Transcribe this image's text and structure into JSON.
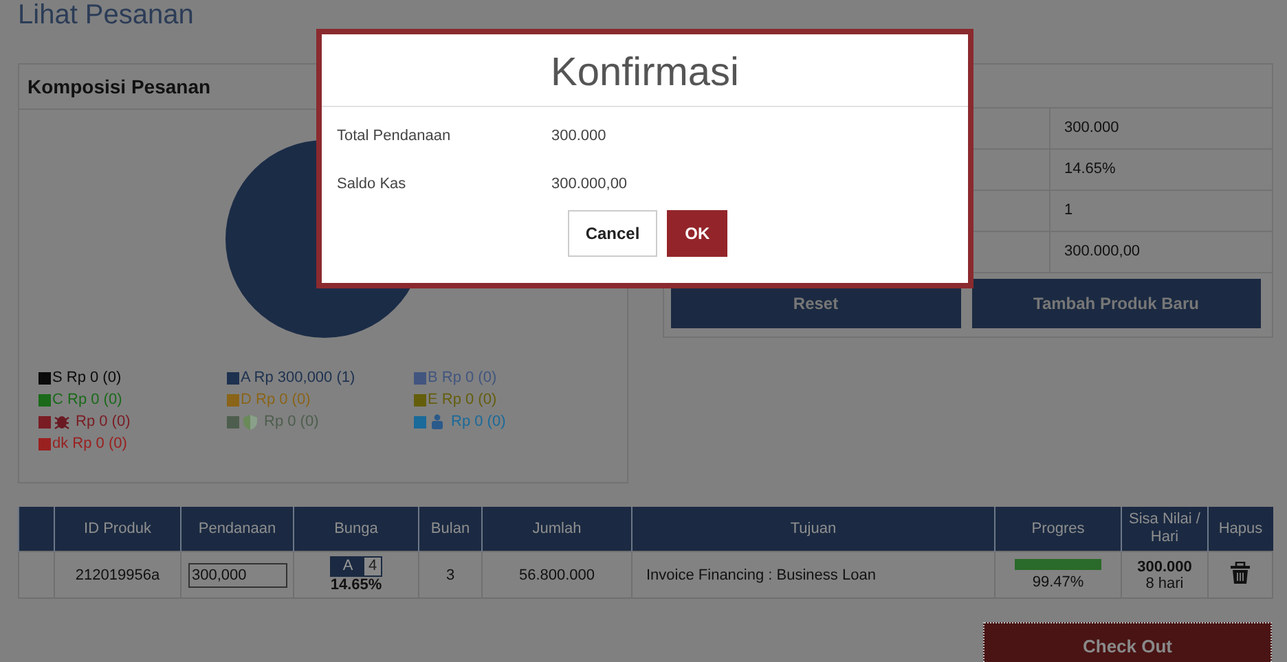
{
  "page": {
    "title": "Lihat Pesanan"
  },
  "composition_panel": {
    "title": "Komposisi Pesanan",
    "legend": [
      {
        "kind": "text",
        "label": "S Rp 0 (0)",
        "color": "#0a0a0a"
      },
      {
        "kind": "text",
        "label": "A Rp 300,000 (1)",
        "color": "#1e3250"
      },
      {
        "kind": "text",
        "label": "B Rp 0 (0)",
        "color": "#41557f"
      },
      {
        "kind": "text",
        "label": "C Rp 0 (0)",
        "color": "#1a6a1a"
      },
      {
        "kind": "text",
        "label": "D Rp 0 (0)",
        "color": "#8a6418"
      },
      {
        "kind": "text",
        "label": "E Rp 0 (0)",
        "color": "#645e0c"
      },
      {
        "kind": "icon",
        "label": "Rp 0 (0)",
        "color": "#7a1c24"
      },
      {
        "kind": "icon",
        "label": "Rp 0 (0)",
        "color": "#4e5e4e"
      },
      {
        "kind": "icon",
        "label": "Rp 0 (0)",
        "color": "#1a6a9a"
      },
      {
        "kind": "text",
        "label": "dk Rp 0 (0)",
        "color": "#9a2020"
      }
    ]
  },
  "summary_panel": {
    "values": [
      "300.000",
      "14.65%",
      "1",
      "300.000,00"
    ],
    "buttons": [
      "Reset",
      "Tambah Produk Baru"
    ]
  },
  "table": {
    "columns": [
      "ID Produk",
      "Pendanaan",
      "Bunga",
      "Bulan",
      "Jumlah",
      "Tujuan",
      "Progres",
      "Sisa Nilai / Hari",
      "Hapus"
    ],
    "rows": [
      {
        "id": "212019956a",
        "pendanaan": "300,000",
        "grade": "A",
        "grade_number": "4",
        "bunga": "14.65%",
        "bulan": "3",
        "jumlah": "56.800.000",
        "tujuan": "Invoice Financing : Business Loan",
        "level": 0.9947,
        "progress_reading": "99.47%",
        "sisa": "300.000",
        "sisa_hari": "8 hari"
      }
    ]
  },
  "checkout_button": "Check Out",
  "dialog": {
    "title": "Konfirmasi",
    "fields": [
      {
        "label": "Total Pendanaan",
        "value": "300.000"
      },
      {
        "label": "Saldo Kas",
        "value": "300.000,00"
      }
    ],
    "buttons": [
      {
        "label": "Cancel",
        "kind": "secondary"
      },
      {
        "label": "OK",
        "kind": "primary"
      }
    ]
  }
}
